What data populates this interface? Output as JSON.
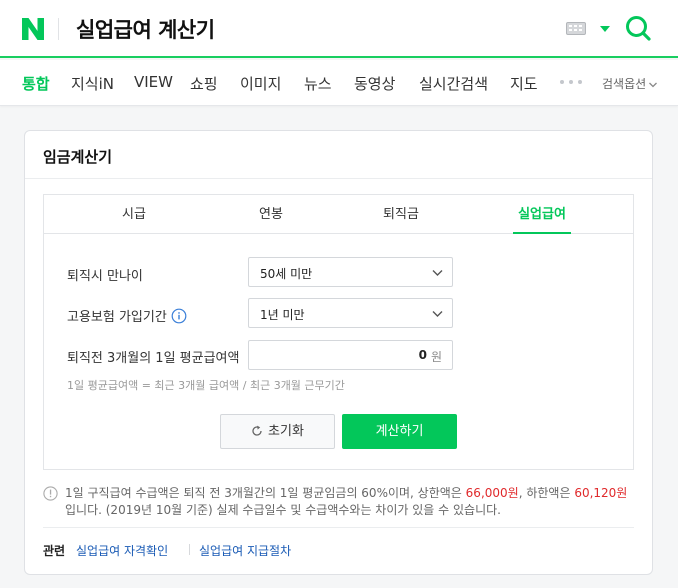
{
  "header": {
    "logo_letter": "N",
    "search_query": "실업급여 계산기",
    "brand_color": "#03c75a"
  },
  "tabs": [
    {
      "label": "통합",
      "active": true
    },
    {
      "label": "지식iN"
    },
    {
      "label": "VIEW"
    },
    {
      "label": "쇼핑"
    },
    {
      "label": "이미지"
    },
    {
      "label": "뉴스"
    },
    {
      "label": "동영상"
    },
    {
      "label": "실시간검색"
    },
    {
      "label": "지도"
    }
  ],
  "search_options_label": "검색옵션",
  "card": {
    "title": "임금계산기",
    "calc_tabs": [
      {
        "label": "시급"
      },
      {
        "label": "연봉"
      },
      {
        "label": "퇴직금"
      },
      {
        "label": "실업급여",
        "active": true
      }
    ],
    "fields": {
      "age_label": "퇴직시 만나이",
      "age_value": "50세 미만",
      "insurance_label": "고용보험 가입기간",
      "insurance_value": "1년 미만",
      "wage_label": "퇴직전 3개월의 1일 평균급여액",
      "wage_value": "0",
      "wage_unit": "원"
    },
    "formula": "1일 평균급여액 = 최근 3개월 급여액 / 최근 3개월 근무기간",
    "reset_label": "초기화",
    "calc_label": "계산하기",
    "notice": {
      "part1": "1일 구직급여 수급액은 퇴직 전 3개월간의 1일 평균임금의 60%이며, 상한액은 ",
      "upper": "66,000원",
      "part2": ", 하한액은 ",
      "lower": "60,120원",
      "part3": "입니다. (2019년 10월 기준) 실제 수급일수 및 수급액수와는 차이가 있을 수 있습니다."
    },
    "related": {
      "label": "관련",
      "links": [
        "실업급여 자격확인",
        "실업급여 지급절차"
      ]
    }
  }
}
